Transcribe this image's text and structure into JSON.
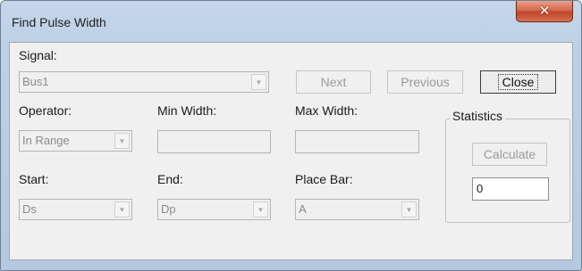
{
  "window": {
    "title": "Find Pulse Width",
    "close_glyph": "✕"
  },
  "signal": {
    "label": "Signal:",
    "value": "Bus1"
  },
  "buttons": {
    "next": "Next",
    "previous": "Previous",
    "close": "Close",
    "calculate": "Calculate"
  },
  "operator": {
    "label": "Operator:",
    "value": "In Range"
  },
  "min_width": {
    "label": "Min Width:",
    "value": ""
  },
  "max_width": {
    "label": "Max Width:",
    "value": ""
  },
  "statistics": {
    "label": "Statistics",
    "result": "0"
  },
  "start": {
    "label": "Start:",
    "value": "Ds"
  },
  "end": {
    "label": "End:",
    "value": "Dp"
  },
  "place_bar": {
    "label": "Place Bar:",
    "value": "A"
  },
  "icons": {
    "dropdown": "chevron-down-icon",
    "close": "close-icon"
  }
}
